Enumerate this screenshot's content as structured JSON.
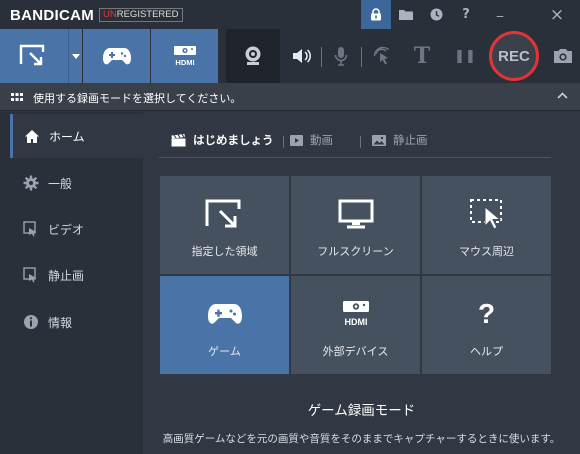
{
  "app": {
    "logo": "BANDICAM",
    "badge_u": "UN",
    "badge_rest": "REGISTERED"
  },
  "titlebar": {
    "icons": [
      "lock-icon",
      "folder-icon",
      "clock-icon",
      "help-icon",
      "minimize-icon",
      "close-icon"
    ],
    "help_label": "?",
    "minimize_label": "_",
    "close_label": "×"
  },
  "toolbar": {
    "rec_label": "REC",
    "text_tool_label": "T",
    "pause_label": "❚❚",
    "hdmi_label": "HDMI"
  },
  "modebar": {
    "text": "使用する録画モードを選択してください。",
    "collapse_label": "^"
  },
  "sidebar": {
    "items": [
      {
        "label": "ホーム",
        "icon": "home-icon"
      },
      {
        "label": "一般",
        "icon": "gear-icon"
      },
      {
        "label": "ビデオ",
        "icon": "video-icon"
      },
      {
        "label": "静止画",
        "icon": "image-icon"
      },
      {
        "label": "情報",
        "icon": "info-icon"
      }
    ]
  },
  "tabs": [
    {
      "label": "はじめましょう",
      "icon": "clapper-icon"
    },
    {
      "label": "動画",
      "icon": "video-icon"
    },
    {
      "label": "静止画",
      "icon": "image-icon"
    }
  ],
  "tiles": [
    {
      "label": "指定した領域",
      "icon": "rectangle-cursor-icon"
    },
    {
      "label": "フルスクリーン",
      "icon": "monitor-icon"
    },
    {
      "label": "マウス周辺",
      "icon": "mouse-area-icon"
    },
    {
      "label": "ゲーム",
      "icon": "gamepad-icon"
    },
    {
      "label": "外部デバイス",
      "icon": "hdmi-icon",
      "icon_text": "HDMI"
    },
    {
      "label": "ヘルプ",
      "icon": "help-icon",
      "icon_text": "?"
    }
  ],
  "description": {
    "title": "ゲーム録画モード",
    "text": "高画質ゲームなどを元の画質や音質をそのままでキャプチャーするときに使います。"
  },
  "colors": {
    "accent": "#4a73a8",
    "rec_ring": "#e23434",
    "tile": "#465160",
    "background": "#313843"
  }
}
